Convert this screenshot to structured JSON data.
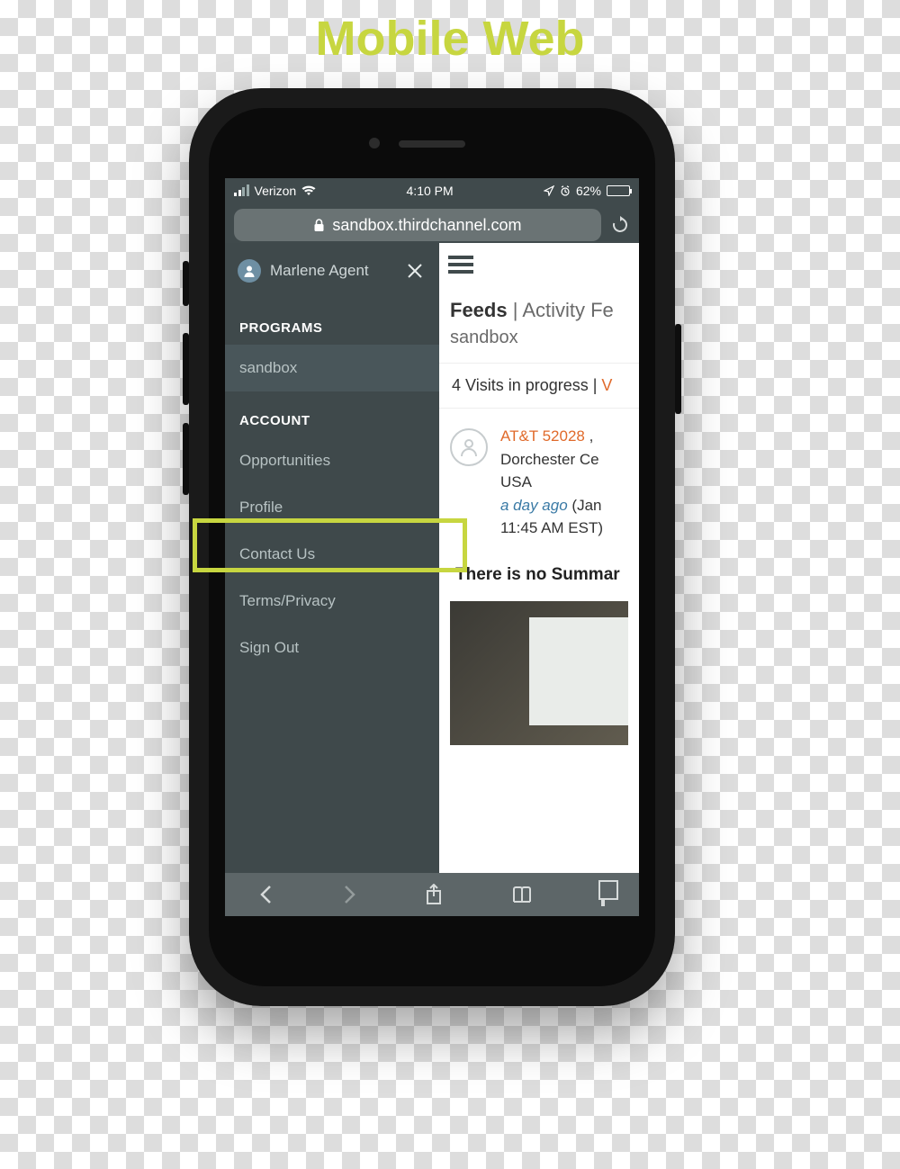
{
  "page_heading": "Mobile Web",
  "highlight_target": "sidebar-item-profile",
  "statusbar": {
    "carrier": "Verizon",
    "time": "4:10 PM",
    "battery_pct": "62%"
  },
  "browser": {
    "url": "sandbox.thirdchannel.com"
  },
  "drawer": {
    "user_name": "Marlene Agent",
    "sections": {
      "programs_title": "PROGRAMS",
      "account_title": "ACCOUNT"
    },
    "programs": [
      {
        "label": "sandbox",
        "selected": true
      }
    ],
    "account": [
      {
        "label": "Opportunities"
      },
      {
        "label": "Profile"
      },
      {
        "label": "Contact Us"
      },
      {
        "label": "Terms/Privacy"
      },
      {
        "label": "Sign Out"
      }
    ]
  },
  "main": {
    "crumb_strong": "Feeds",
    "crumb_sep": " | ",
    "crumb_rest": "Activity Fe",
    "crumb_sub": "sandbox",
    "visits_text": "4 Visits in progress | ",
    "visits_link": "V",
    "feed": {
      "store": "AT&T 52028",
      "store_tail": " , ",
      "line2": "Dorchester Ce",
      "line3": "USA",
      "ago": "a day ago",
      "ago_tail": " (Jan",
      "time": "11:45 AM EST)"
    },
    "summary": "There is no Summar"
  }
}
